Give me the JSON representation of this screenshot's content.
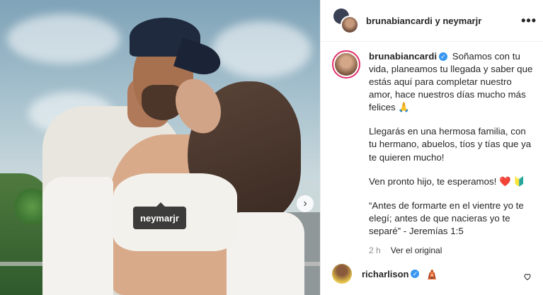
{
  "photo": {
    "tag_label": "neymarjr",
    "next_icon": "›"
  },
  "header": {
    "title": "brunabiancardi y neymarjr",
    "more_icon": "•••"
  },
  "caption": {
    "username": "brunabiancardi",
    "verified_icon": "✓",
    "paragraphs": [
      "Soñamos con tu vida, planeamos tu llegada y saber que estás aquí para completar nuestro amor, hace nuestros días mucho más felices 🙏",
      "Llegarás en una hermosa familia, con tu hermano, abuelos, tíos y tías que ya te quieren mucho!",
      "Ven pronto hijo, te esperamos! ❤️ 🔰",
      "“Antes de formarte en el vientre yo te elegí; antes de que nacieras yo te separé” - Jeremías 1:5"
    ],
    "time": "2 h",
    "see_original": "Ver el original"
  },
  "comment": {
    "username": "richarlison",
    "verified_icon": "✓",
    "emoji": "🛕"
  }
}
